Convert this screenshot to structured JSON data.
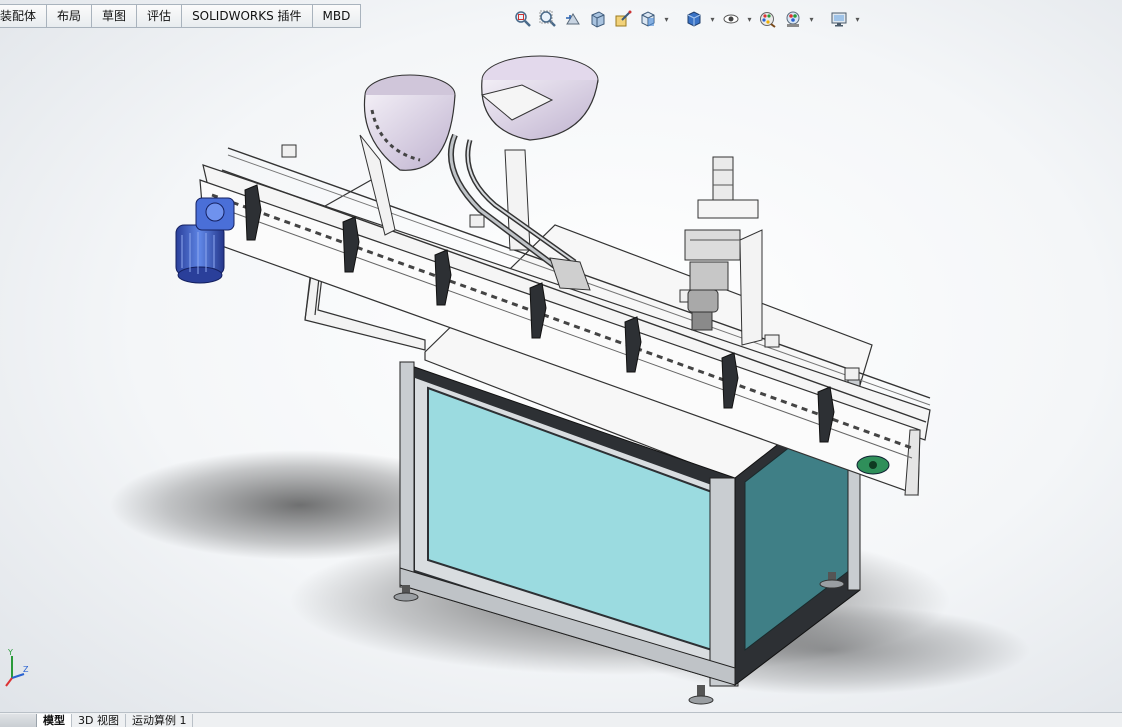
{
  "command_tabs": [
    "装配体",
    "布局",
    "草图",
    "评估",
    "SOLIDWORKS 插件",
    "MBD"
  ],
  "hud_icons": [
    {
      "name": "zoom-to-fit-icon",
      "caret": false
    },
    {
      "name": "zoom-to-area-icon",
      "caret": false
    },
    {
      "name": "previous-view-icon",
      "caret": false
    },
    {
      "name": "section-view-icon",
      "caret": false
    },
    {
      "name": "dynamic-annotation-icon",
      "caret": false
    },
    {
      "name": "view-orientation-icon",
      "caret": true
    },
    {
      "name": "display-style-icon",
      "caret": true
    },
    {
      "name": "hide-show-items-icon",
      "caret": true
    },
    {
      "name": "edit-appearance-icon",
      "caret": false
    },
    {
      "name": "apply-scene-icon",
      "caret": true
    },
    {
      "name": "view-settings-icon",
      "caret": true
    }
  ],
  "triad": {
    "y": "Y",
    "z": "Z"
  },
  "bottom_tabs": [
    {
      "label": "模型",
      "active": true
    },
    {
      "label": "3D 视图",
      "active": false
    },
    {
      "label": "运动算例 1",
      "active": false
    }
  ],
  "colors": {
    "panel_cyan": "#9bdbe0",
    "panel_teal": "#3f7f86",
    "frame_dark": "#2d3034",
    "motor_blue": "#3f62c8",
    "bowl_lilac": "#d9cde4",
    "accent_green": "#2f8f5a"
  }
}
